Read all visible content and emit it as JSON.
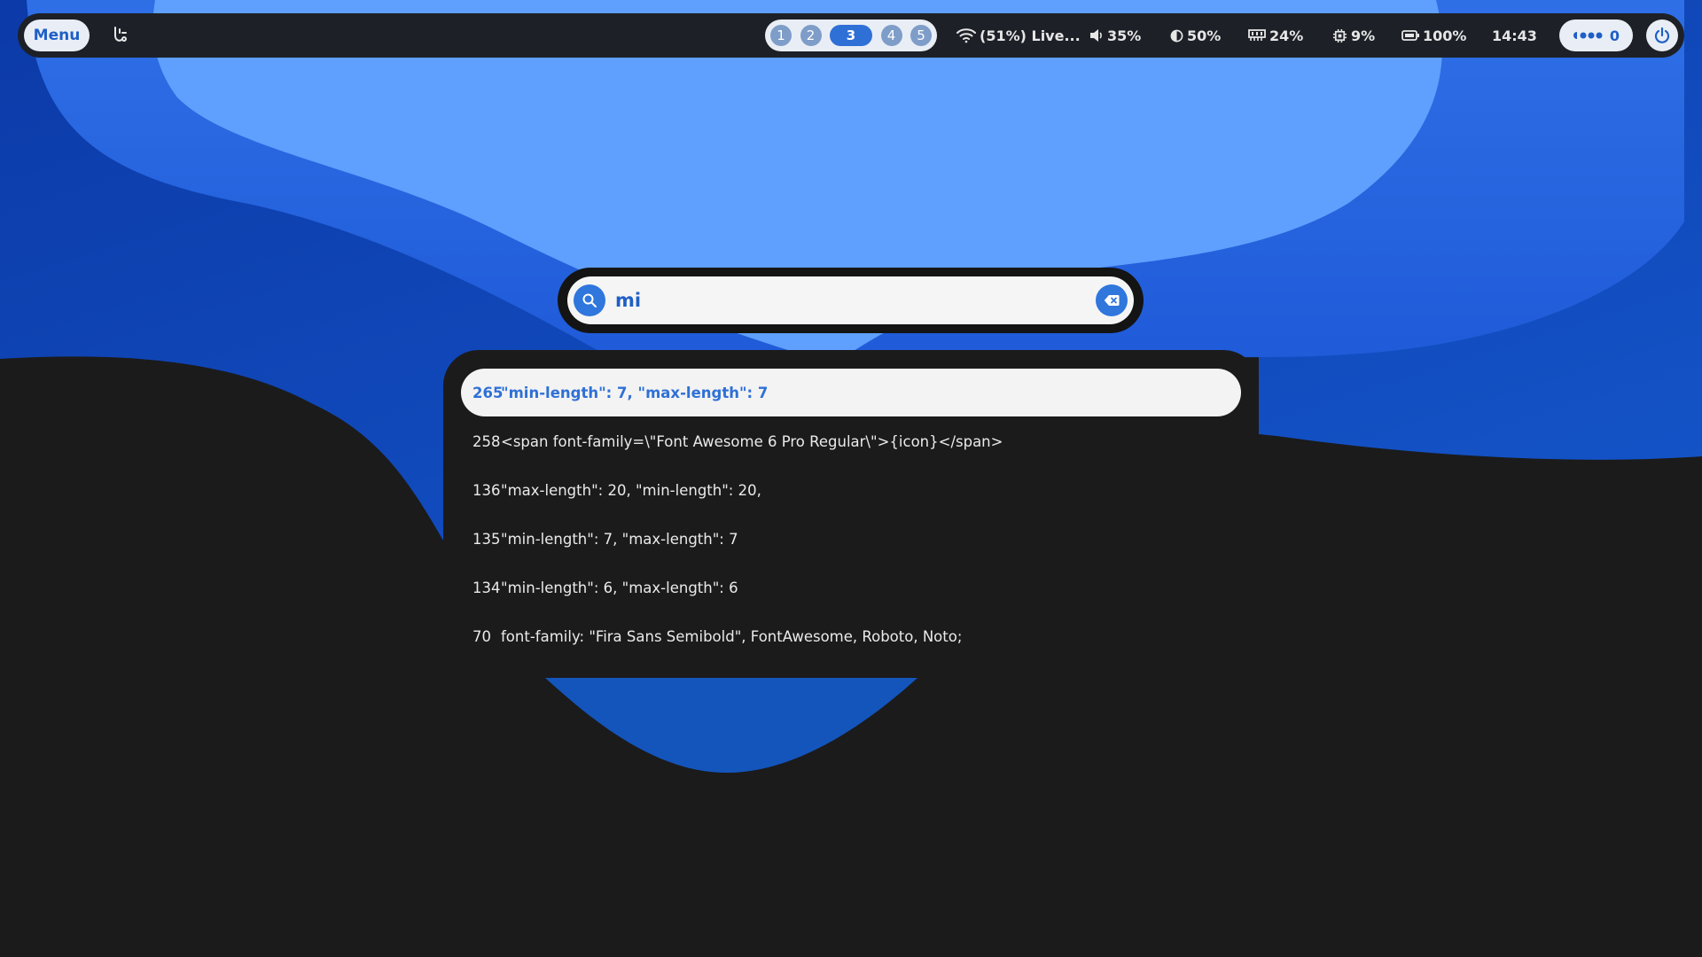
{
  "colors": {
    "accent": "#2f70d6",
    "bar_bg": "#1d2127",
    "panel_bg": "#1b1b1c",
    "wallpaper_light": "#5f9ffd",
    "wallpaper_dark": "#0e43b8"
  },
  "topbar": {
    "menu_label": "Menu",
    "launcher_icon": "flask-icon",
    "workspaces": [
      {
        "label": "1",
        "active": false
      },
      {
        "label": "2",
        "active": false
      },
      {
        "label": "3",
        "active": true
      },
      {
        "label": "4",
        "active": false
      },
      {
        "label": "5",
        "active": false
      }
    ],
    "network": {
      "icon": "wifi-icon",
      "text": "(51%) Live..."
    },
    "volume": {
      "icon": "speaker-icon",
      "text": "35%"
    },
    "brightness": {
      "icon": "brightness-icon",
      "text": "50%"
    },
    "memory": {
      "icon": "memory-icon",
      "text": "24%"
    },
    "cpu": {
      "icon": "cpu-icon",
      "text": "9%"
    },
    "battery": {
      "icon": "battery-icon",
      "text": "100%"
    },
    "clock": "14:43",
    "notifications": {
      "icon": "dots-icon",
      "count": "0"
    },
    "power_icon": "power-icon"
  },
  "search": {
    "query": "mi",
    "search_icon": "search-icon",
    "clear_icon": "backspace-icon"
  },
  "results": [
    {
      "num": "265",
      "text": "\"min-length\": 7, \"max-length\": 7",
      "selected": true
    },
    {
      "num": "258",
      "text": "<span font-family=\\\"Font Awesome 6 Pro Regular\\\">{icon}</span>",
      "selected": false
    },
    {
      "num": "136",
      "text": "\"max-length\": 20, \"min-length\": 20,",
      "selected": false
    },
    {
      "num": "135",
      "text": "\"min-length\": 7, \"max-length\": 7",
      "selected": false
    },
    {
      "num": "134",
      "text": "\"min-length\": 6, \"max-length\": 6",
      "selected": false
    },
    {
      "num": "70",
      "text": "font-family: \"Fira Sans Semibold\", FontAwesome, Roboto, Noto;",
      "selected": false
    }
  ]
}
